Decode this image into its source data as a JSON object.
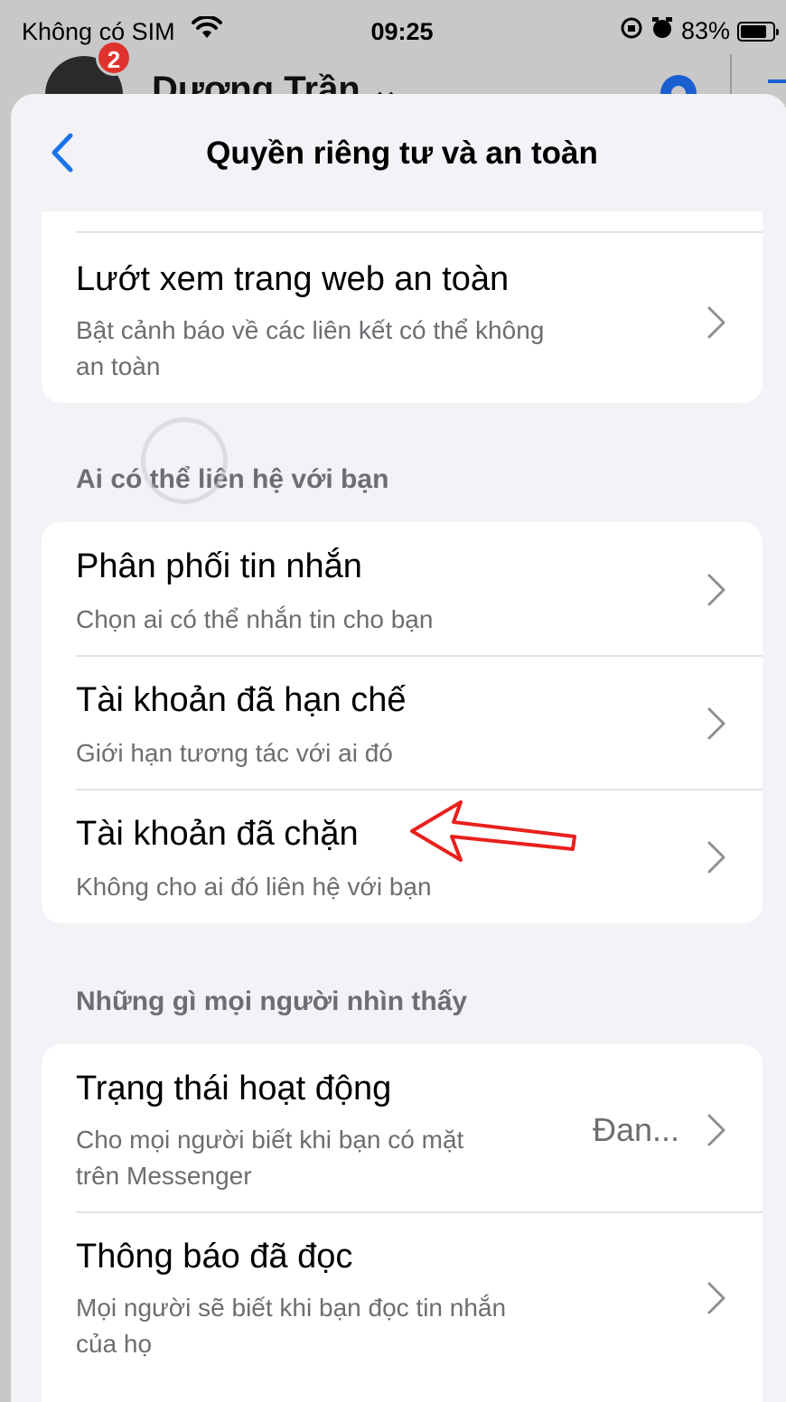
{
  "status_bar": {
    "carrier": "Không có SIM",
    "time": "09:25",
    "battery": "83%",
    "battery_level": 0.83
  },
  "background_app": {
    "badge_count": "2",
    "profile_name": "Dương Trần ⌄"
  },
  "nav": {
    "title": "Quyền riêng tư và an toàn"
  },
  "safe_browsing": {
    "title": "Lướt xem trang web an toàn",
    "subtitle_line1": "Bật cảnh báo về các liên kết có thể không",
    "subtitle_line2": "an toàn"
  },
  "section_contact": {
    "header": "Ai có thể liên hệ với bạn",
    "items": [
      {
        "title": "Phân phối tin nhắn",
        "subtitle": "Chọn ai có thể nhắn tin cho bạn"
      },
      {
        "title": "Tài khoản đã hạn chế",
        "subtitle": "Giới hạn tương tác với ai đó"
      },
      {
        "title": "Tài khoản đã chặn",
        "subtitle": "Không cho ai đó liên hệ với bạn"
      }
    ]
  },
  "section_visibility": {
    "header": "Những gì mọi người nhìn thấy",
    "items": [
      {
        "title": "Trạng thái hoạt động",
        "subtitle_line1": "Cho mọi người biết khi bạn có mặt",
        "subtitle_line2": "trên Messenger",
        "value": "Đan..."
      },
      {
        "title": "Thông báo đã đọc",
        "subtitle_line1": "Mọi người sẽ biết khi bạn đọc tin nhắn",
        "subtitle_line2": "của họ"
      }
    ]
  },
  "colors": {
    "accent": "#1a73e8",
    "annotation_arrow": "#e8201c",
    "badge": "#e0322d"
  }
}
